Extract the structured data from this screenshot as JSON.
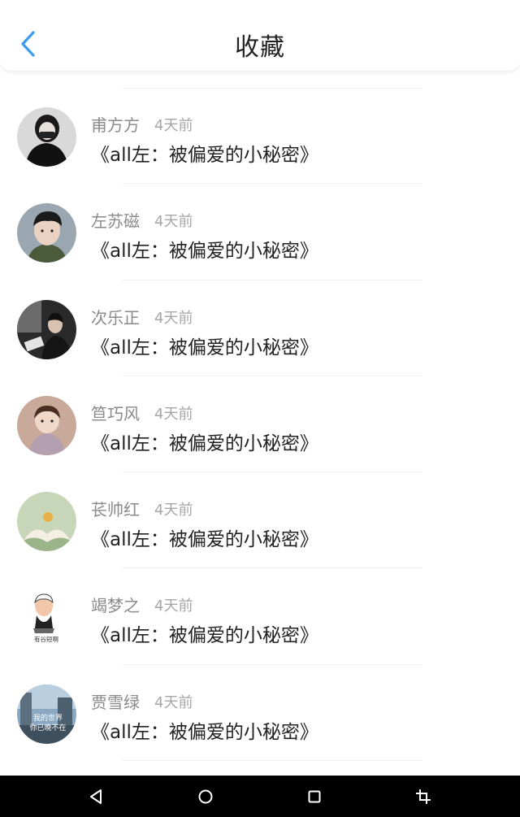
{
  "header": {
    "title": "收藏",
    "back_icon": "chevron-left-icon",
    "accent": "#3a9cf0"
  },
  "favorites": [
    {
      "author": "甫方方",
      "time": "4天前",
      "title": "《all左：被偏爱的小秘密》"
    },
    {
      "author": "左苏磁",
      "time": "4天前",
      "title": "《all左：被偏爱的小秘密》"
    },
    {
      "author": "次乐正",
      "time": "4天前",
      "title": "《all左：被偏爱的小秘密》"
    },
    {
      "author": "笪巧风",
      "time": "4天前",
      "title": "《all左：被偏爱的小秘密》"
    },
    {
      "author": "苌帅红",
      "time": "4天前",
      "title": "《all左：被偏爱的小秘密》"
    },
    {
      "author": "竭梦之",
      "time": "4天前",
      "title": "《all左：被偏爱的小秘密》"
    },
    {
      "author": "贾雪绿",
      "time": "4天前",
      "title": "《all左：被偏爱的小秘密》"
    }
  ],
  "avatar_texts": {
    "item6": "有谷短啊",
    "item7_line1": "我的世界",
    "item7_line2": "你已晚不在"
  },
  "navbar": {
    "icons": [
      "back-triangle-icon",
      "home-circle-icon",
      "recents-square-icon",
      "screenshot-crop-icon"
    ]
  }
}
